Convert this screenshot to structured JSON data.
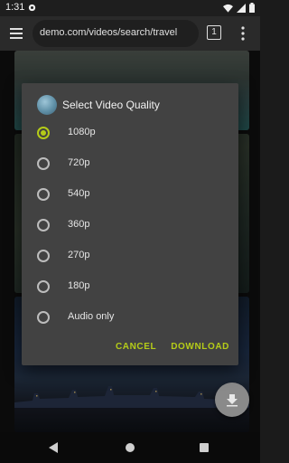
{
  "status_bar": {
    "time": "1:31"
  },
  "browser": {
    "url": "demo.com/videos/search/travel",
    "tab_count": "1"
  },
  "dialog": {
    "title": "Select Video Quality",
    "options": [
      {
        "label": "1080p",
        "selected": true
      },
      {
        "label": "720p",
        "selected": false
      },
      {
        "label": "540p",
        "selected": false
      },
      {
        "label": "360p",
        "selected": false
      },
      {
        "label": "270p",
        "selected": false
      },
      {
        "label": "180p",
        "selected": false
      },
      {
        "label": "Audio only",
        "selected": false
      }
    ],
    "cancel_label": "CANCEL",
    "download_label": "DOWNLOAD"
  },
  "colors": {
    "accent": "#b5cc18",
    "dialog_bg": "#424242",
    "toolbar_bg": "#2a2a2a"
  },
  "icons": {
    "status": [
      "gear-icon",
      "wifi-icon",
      "signal-icon",
      "battery-icon"
    ],
    "toolbar": [
      "menu-icon",
      "tab-switcher-icon",
      "overflow-menu-icon"
    ],
    "fab": "download-icon",
    "nav": [
      "back-icon",
      "home-icon",
      "recents-icon"
    ]
  }
}
